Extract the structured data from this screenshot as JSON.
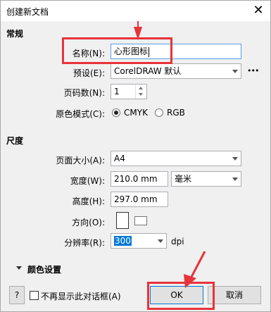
{
  "window": {
    "title": "创建新文档",
    "close_glyph": "✕"
  },
  "sections": {
    "general": "常规",
    "dimensions": "尺度",
    "color_settings": "颜色设置"
  },
  "fields": {
    "name_label": "名称(N):",
    "name_value": "心形图标",
    "preset_label": "预设(E):",
    "preset_value": "CorelDRAW 默认",
    "more_glyph": "•••",
    "pages_label": "页码数(N):",
    "pages_value": "1",
    "color_mode_label": "原色模式(C):",
    "color_mode_cmyk": "CMYK",
    "color_mode_rgb": "RGB",
    "color_mode_selected": "CMYK",
    "page_size_label": "页面大小(A):",
    "page_size_value": "A4",
    "width_label": "宽度(W):",
    "width_value": "210.0 mm",
    "units_value": "毫米",
    "height_label": "高度(H):",
    "height_value": "297.0 mm",
    "orientation_label": "方向(O):",
    "resolution_label": "分辨率(R):",
    "resolution_value": "300",
    "resolution_unit": "dpi"
  },
  "footer": {
    "help_label": "?",
    "dont_show_label": "不再显示此对话框(A)",
    "ok_label": "OK",
    "cancel_label": "取消"
  },
  "colors": {
    "annotation_red": "#e8333a",
    "focus_blue": "#0078d7"
  }
}
